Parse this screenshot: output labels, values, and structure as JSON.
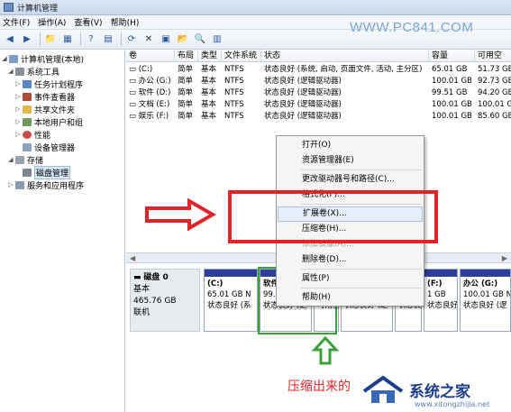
{
  "window": {
    "title": "计算机管理"
  },
  "menu": [
    "文件(F)",
    "操作(A)",
    "查看(V)",
    "帮助(H)"
  ],
  "watermark": "WWW.PC841.COM",
  "toolbar": {
    "icons": [
      "back-arrow",
      "forward-arrow",
      "up-folder",
      "show-hide-tree",
      "help",
      "properties",
      "refresh",
      "delete",
      "properties-sheet",
      "open",
      "search",
      "view"
    ]
  },
  "tree": {
    "items": [
      {
        "label": "计算机管理(本地)",
        "level": 0,
        "expander": "down"
      },
      {
        "label": "系统工具",
        "level": 1,
        "expander": "down"
      },
      {
        "label": "任务计划程序",
        "level": 2,
        "expander": "right"
      },
      {
        "label": "事件查看器",
        "level": 2,
        "expander": "right"
      },
      {
        "label": "共享文件夹",
        "level": 2,
        "expander": "right"
      },
      {
        "label": "本地用户和组",
        "level": 2,
        "expander": "right"
      },
      {
        "label": "性能",
        "level": 2,
        "expander": "right"
      },
      {
        "label": "设备管理器",
        "level": 2,
        "expander": ""
      },
      {
        "label": "存储",
        "level": 1,
        "expander": "down"
      },
      {
        "label": "磁盘管理",
        "level": 2,
        "expander": "",
        "selected": true
      },
      {
        "label": "服务和应用程序",
        "level": 1,
        "expander": "right"
      }
    ]
  },
  "volumes": {
    "columns": [
      "卷",
      "布局",
      "类型",
      "文件系统",
      "状态",
      "容量",
      "可用空"
    ],
    "rows": [
      [
        "(C:)",
        "简单",
        "基本",
        "NTFS",
        "状态良好 (系统, 启动, 页面文件, 活动, 主分区)",
        "65.01 GB",
        "51.73 GB"
      ],
      [
        "办公 (G:)",
        "简单",
        "基本",
        "NTFS",
        "状态良好 (逻辑驱动器)",
        "100.01 GB",
        "92.73 GB"
      ],
      [
        "软件 (D:)",
        "简单",
        "基本",
        "NTFS",
        "状态良好 (逻辑驱动器)",
        "99.51 GB",
        "94.20 GB"
      ],
      [
        "文档 (E:)",
        "简单",
        "基本",
        "NTFS",
        "状态良好 (逻辑驱动器)",
        "100.01 GB",
        "100.01 GB"
      ],
      [
        "娱乐 (F:)",
        "简单",
        "基本",
        "NTFS",
        "状态良好 (逻辑驱动器)",
        "100.01 GB",
        "85.60 GB"
      ]
    ]
  },
  "disk": {
    "name": "磁盘 0",
    "type": "基本",
    "size": "465.76 GB",
    "status": "联机",
    "partitions": [
      {
        "name": "(C:)",
        "size": "65.01 GB N",
        "status": "状态良好 (系"
      },
      {
        "name": "软件",
        "size": "99.5",
        "status": "状态良好 (逻"
      },
      {
        "name": "",
        "size": "",
        "status": "可用空"
      },
      {
        "name": "",
        "size": "",
        "status": "状态良好 (逻"
      },
      {
        "name": "",
        "size": "",
        "status": "状态良好 (逻"
      },
      {
        "name": "(F:)",
        "size": "1 GB",
        "status": "状态良好 (逻"
      },
      {
        "name": "办公 (G:)",
        "size": "100.01 GB N",
        "status": "状态良好 (逻"
      }
    ]
  },
  "context_menu": {
    "items": [
      "打开(O)",
      "资源管理器(E)",
      "更改驱动器号和路径(C)...",
      "格式化(F)...",
      "扩展卷(X)...",
      "压缩卷(H)...",
      "添加镜像(A)...",
      "删除卷(D)...",
      "属性(P)",
      "帮助(H)"
    ],
    "disabled": [
      6
    ]
  },
  "annotation": {
    "caption": "压缩出来的"
  },
  "logo": {
    "text": "系统之家",
    "url": "www.xitongzhijia.net"
  },
  "colors": {
    "accent_red": "#e0242a",
    "accent_green": "#3aa13a",
    "partition_blue": "#2c3d9e"
  }
}
